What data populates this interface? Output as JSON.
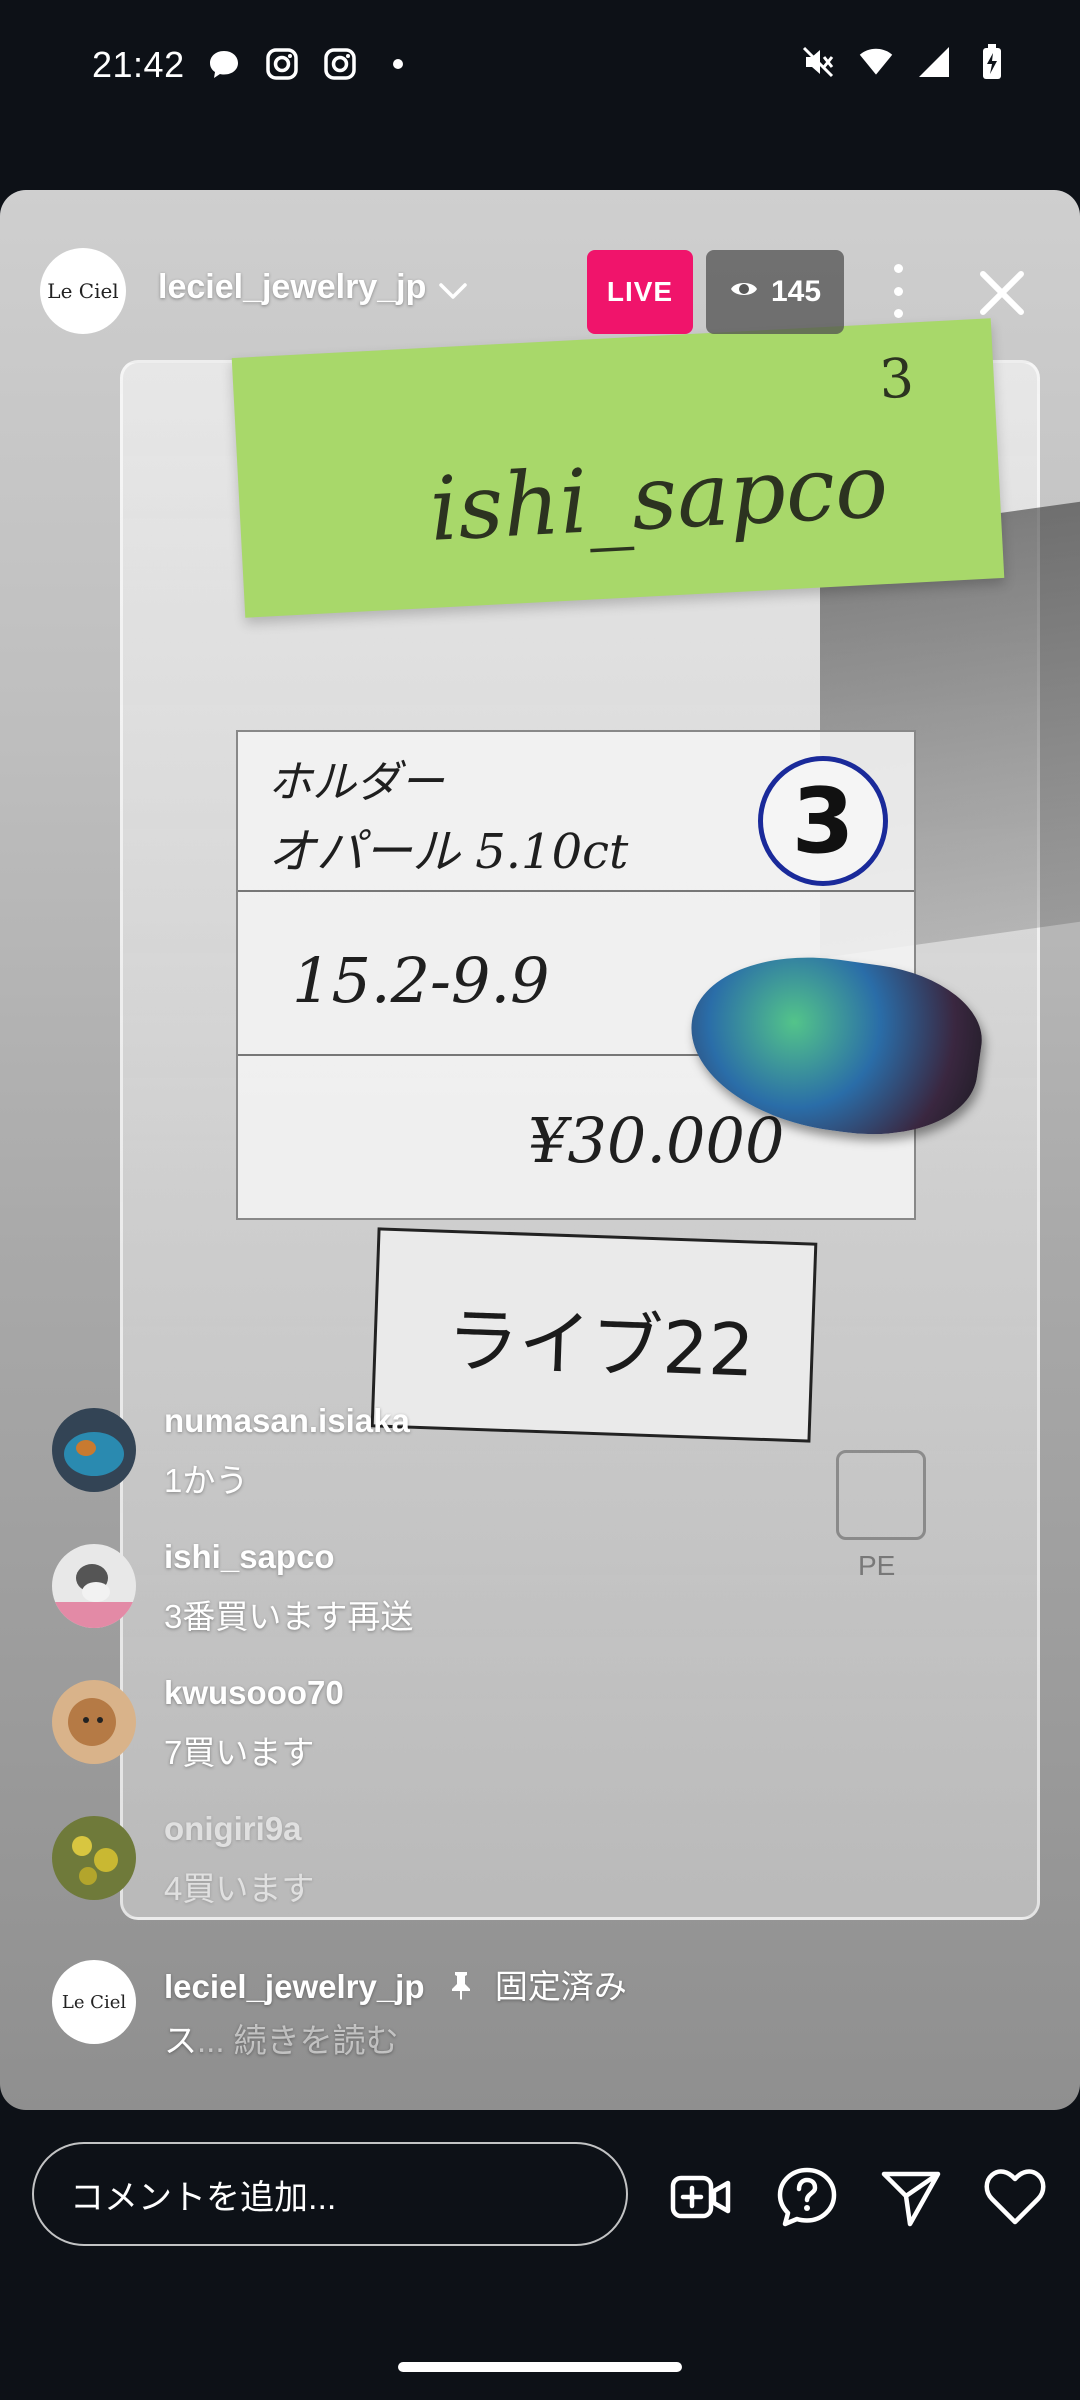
{
  "status_bar": {
    "time": "21:42",
    "left_icons": [
      "chat-bubble-icon",
      "instagram-icon",
      "instagram-icon",
      "dot-icon"
    ],
    "right_icons": [
      "mute-icon",
      "wifi-icon",
      "signal-icon",
      "battery-charging-icon"
    ]
  },
  "live": {
    "username": "leciel_jewelry_jp",
    "avatar_text": "Le Ciel",
    "live_label": "LIVE",
    "viewers": "145"
  },
  "scene": {
    "sticky_text": "ishi_sapco",
    "sticky_number": "3",
    "card_line1": "ホルダー",
    "card_line2": "オパール 5.10ct",
    "card_circle": "3",
    "card_size": "15.2-9.9",
    "card_price": "¥30.000",
    "label_card": "ライブ22",
    "pe_text": "PE"
  },
  "comments": [
    {
      "name": "numasan.isiaka",
      "text": "1かう",
      "avatar": "ocean"
    },
    {
      "name": "ishi_sapco",
      "text": "3番買います再送",
      "avatar": "bird"
    },
    {
      "name": "kwusooo70",
      "text": "7買います",
      "avatar": "dog"
    },
    {
      "name": "onigiri9a",
      "text": "4買います",
      "avatar": "flowers"
    }
  ],
  "pinned": {
    "name": "leciel_jewelry_jp",
    "label": "固定済み",
    "body_start": "ス",
    "read_more": "... 続きを読む"
  },
  "bottom": {
    "placeholder": "コメントを追加..."
  },
  "colors": {
    "live_badge": "#f0146b",
    "background": "#0d1117"
  }
}
